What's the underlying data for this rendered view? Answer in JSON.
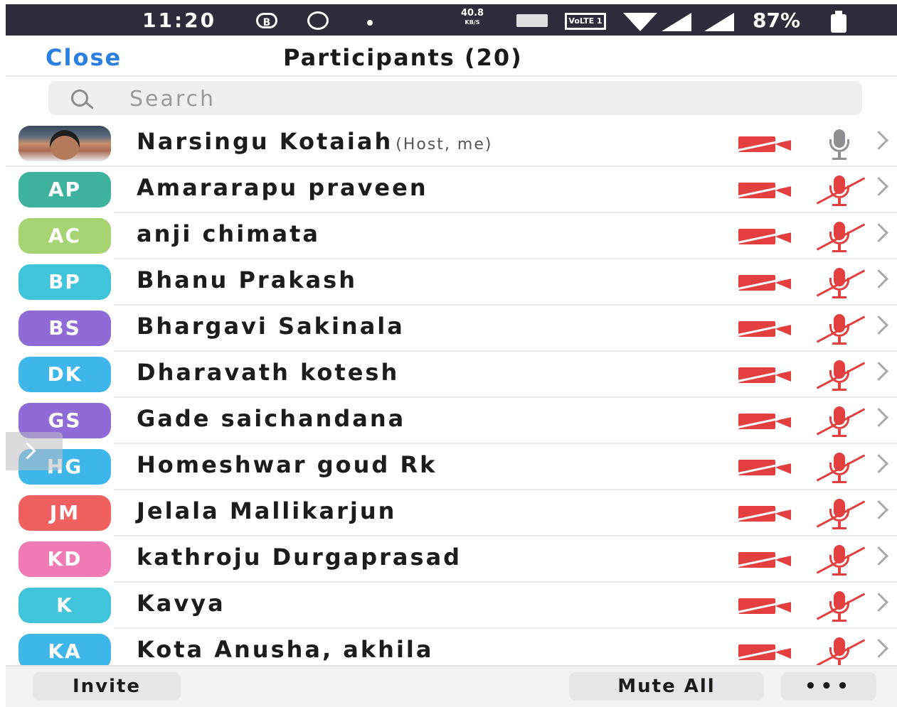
{
  "status_bar": {
    "time": "11:20",
    "icon_b": "B",
    "speed_value": "40.8",
    "speed_unit": "KB/S",
    "volte": "VoLTE 1",
    "battery": "87%"
  },
  "header": {
    "close_label": "Close",
    "title": "Participants (20)"
  },
  "search": {
    "placeholder": "Search"
  },
  "participants": [
    {
      "initials": "",
      "name": "Narsingu Kotaiah",
      "role": "(Host, me)",
      "color": "#6b7a8a",
      "photo": true,
      "video": "off",
      "mic": "on"
    },
    {
      "initials": "AP",
      "name": "Amararapu praveen",
      "role": "",
      "color": "#3db39e",
      "photo": false,
      "video": "off",
      "mic": "muted"
    },
    {
      "initials": "AC",
      "name": "anji chimata",
      "role": "",
      "color": "#a6d472",
      "photo": false,
      "video": "off",
      "mic": "muted"
    },
    {
      "initials": "BP",
      "name": "Bhanu Prakash",
      "role": "",
      "color": "#3fc4d9",
      "photo": false,
      "video": "off",
      "mic": "muted"
    },
    {
      "initials": "BS",
      "name": "Bhargavi Sakinala",
      "role": "",
      "color": "#8e6bd6",
      "photo": false,
      "video": "off",
      "mic": "muted"
    },
    {
      "initials": "DK",
      "name": "Dharavath kotesh",
      "role": "",
      "color": "#3fb6ea",
      "photo": false,
      "video": "off",
      "mic": "muted"
    },
    {
      "initials": "GS",
      "name": "Gade saichandana",
      "role": "",
      "color": "#8e6bd6",
      "photo": false,
      "video": "off",
      "mic": "muted"
    },
    {
      "initials": "HG",
      "name": "Homeshwar goud Rk",
      "role": "",
      "color": "#3fb6ea",
      "photo": false,
      "video": "off",
      "mic": "muted"
    },
    {
      "initials": "JM",
      "name": "Jelala Mallikarjun",
      "role": "",
      "color": "#f06060",
      "photo": false,
      "video": "off",
      "mic": "muted"
    },
    {
      "initials": "KD",
      "name": "kathroju Durgaprasad",
      "role": "",
      "color": "#f07ab4",
      "photo": false,
      "video": "off",
      "mic": "muted"
    },
    {
      "initials": "K",
      "name": "Kavya",
      "role": "",
      "color": "#3fc4d9",
      "photo": false,
      "video": "off",
      "mic": "muted"
    },
    {
      "initials": "KA",
      "name": "Kota Anusha, akhila",
      "role": "",
      "color": "#3fb6ea",
      "photo": false,
      "video": "off",
      "mic": "muted"
    }
  ],
  "footer": {
    "invite_label": "Invite",
    "mute_all_label": "Mute All",
    "more_label": "•••"
  },
  "colors": {
    "accent": "#2a7fe0",
    "muted_red": "#e43f3f",
    "status_bar_bg": "#2c2c3a"
  },
  "icons": {
    "video_off": "video-off-icon",
    "mic_muted": "mic-muted-icon",
    "mic_on": "mic-icon",
    "chevron": "chevron-right-icon",
    "search": "search-icon"
  }
}
